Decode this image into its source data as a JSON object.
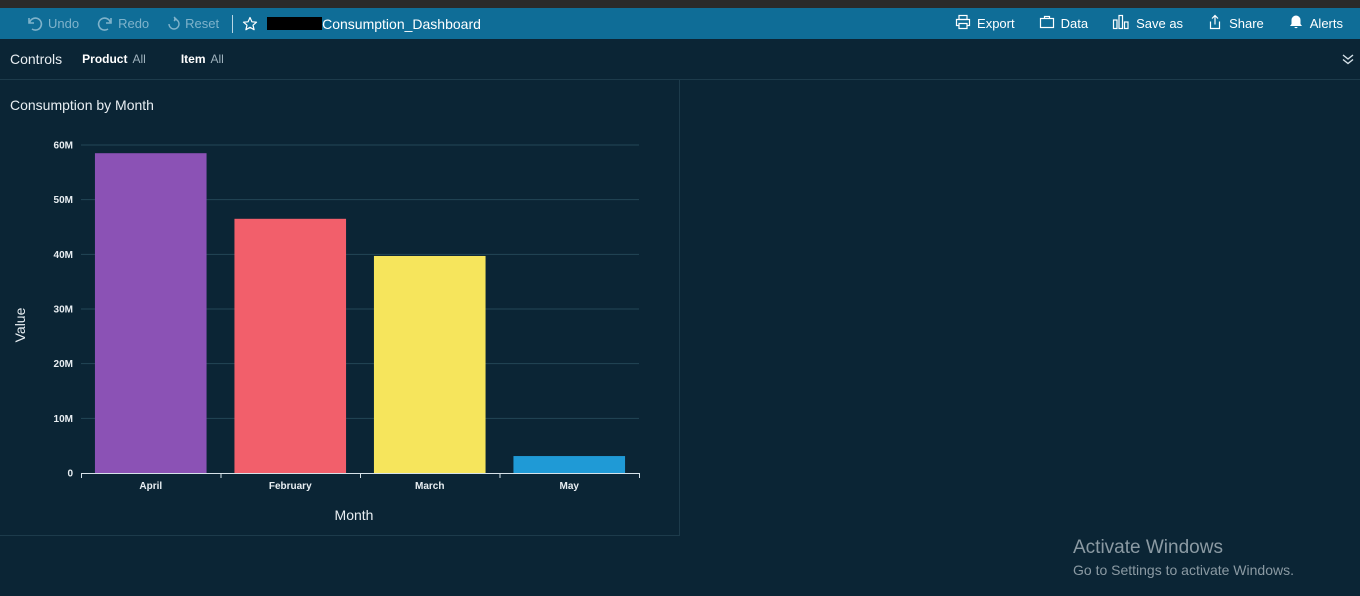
{
  "toolbar": {
    "undo_label": "Undo",
    "redo_label": "Redo",
    "reset_label": "Reset",
    "dashboard_title": "Consumption_Dashboard",
    "actions": [
      "Export",
      "Data",
      "Save as",
      "Share",
      "Alerts"
    ]
  },
  "controls": {
    "title": "Controls",
    "product_label": "Product",
    "product_value": "All",
    "item_label": "Item",
    "item_value": "All"
  },
  "visual": {
    "title": "Consumption by Month"
  },
  "chart_data": {
    "type": "bar",
    "title": "Consumption by Month",
    "xlabel": "Month",
    "ylabel": "Value",
    "categories": [
      "April",
      "February",
      "March",
      "May"
    ],
    "values": [
      58500000,
      46500000,
      39700000,
      3100000
    ],
    "colors": [
      "#8b52b5",
      "#f25f6b",
      "#f6e55c",
      "#1f9ad6"
    ],
    "ylim": [
      0,
      60000000
    ],
    "yticks": [
      0,
      10000000,
      20000000,
      30000000,
      40000000,
      50000000,
      60000000
    ],
    "ytick_labels": [
      "0",
      "10M",
      "20M",
      "30M",
      "40M",
      "50M",
      "60M"
    ],
    "grid": true
  },
  "watermark": {
    "line1": "Activate Windows",
    "line2": "Go to Settings to activate Windows."
  }
}
